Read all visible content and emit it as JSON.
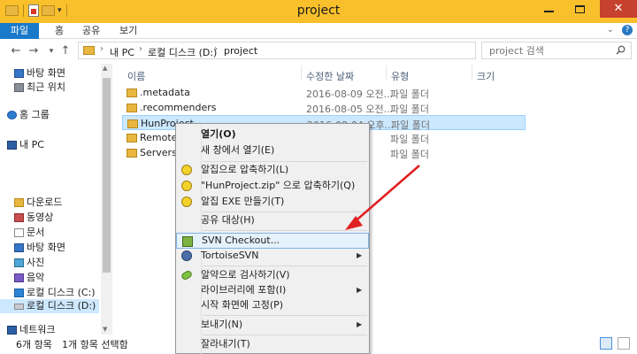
{
  "window": {
    "title": "project",
    "close_glyph": "✕"
  },
  "ribbon": {
    "tabs": [
      "파일",
      "홈",
      "공유",
      "보기"
    ]
  },
  "address": {
    "segments": [
      "내 PC",
      "로컬 디스크 (D:)",
      "project"
    ],
    "search_placeholder": "project 검색"
  },
  "sidebar": {
    "items": [
      "바탕 화면",
      "최근 위치",
      "홈 그룹",
      "내 PC",
      "다운로드",
      "동영상",
      "문서",
      "바탕 화면",
      "사진",
      "음악",
      "로컬 디스크 (C:)",
      "로컬 디스크 (D:)",
      "네트워크"
    ],
    "selected": "로컬 디스크 (D:)"
  },
  "columns": {
    "name": "이름",
    "date": "수정한 날짜",
    "type": "유형",
    "size": "크기"
  },
  "files": [
    {
      "name": ".metadata",
      "date": "2016-08-09 오전...",
      "type": "파일 폴더"
    },
    {
      "name": ".recommenders",
      "date": "2016-08-05 오전...",
      "type": "파일 폴더"
    },
    {
      "name": "HunProject",
      "date": "2016-08-04 오후...",
      "type": "파일 폴더",
      "selected": true
    },
    {
      "name": "RemoteSystemsTempFiles",
      "date": "",
      "type": "파일 폴더"
    },
    {
      "name": "Servers",
      "date": "",
      "type": "파일 폴더"
    }
  ],
  "context_menu": {
    "open": "열기",
    "open_key": "(O)",
    "open_new_window": "새 창에서 열기",
    "open_new_window_key": "(E)",
    "alzip_compress": "알집으로 압축하기",
    "alzip_compress_key": "(L)",
    "compress_zip": "\"HunProject.zip\" 으로 압축하기",
    "compress_zip_key": "(Q)",
    "alzip_exe": "알집 EXE 만들기",
    "alzip_exe_key": "(T)",
    "share_with": "공유 대상",
    "share_with_key": "(H)",
    "svn_checkout": "SVN Checkout...",
    "tortoise_svn": "TortoiseSVN",
    "alyac_scan": "알약으로 검사하기",
    "alyac_scan_key": "(V)",
    "include_library": "라이브러리에 포함",
    "include_library_key": "(I)",
    "pin_start": "시작 화면에 고정",
    "pin_start_key": "(P)",
    "send_to": "보내기",
    "send_to_key": "(N)",
    "cut": "잘라내기",
    "cut_key": "(T)"
  },
  "status": {
    "count": "6개 항목",
    "selected": "1개 항목 선택함"
  },
  "colors": {
    "title_bar": "#f9c02b",
    "file_tab": "#1979ca",
    "selection": "#cce8ff",
    "arrow": "#e02020"
  }
}
